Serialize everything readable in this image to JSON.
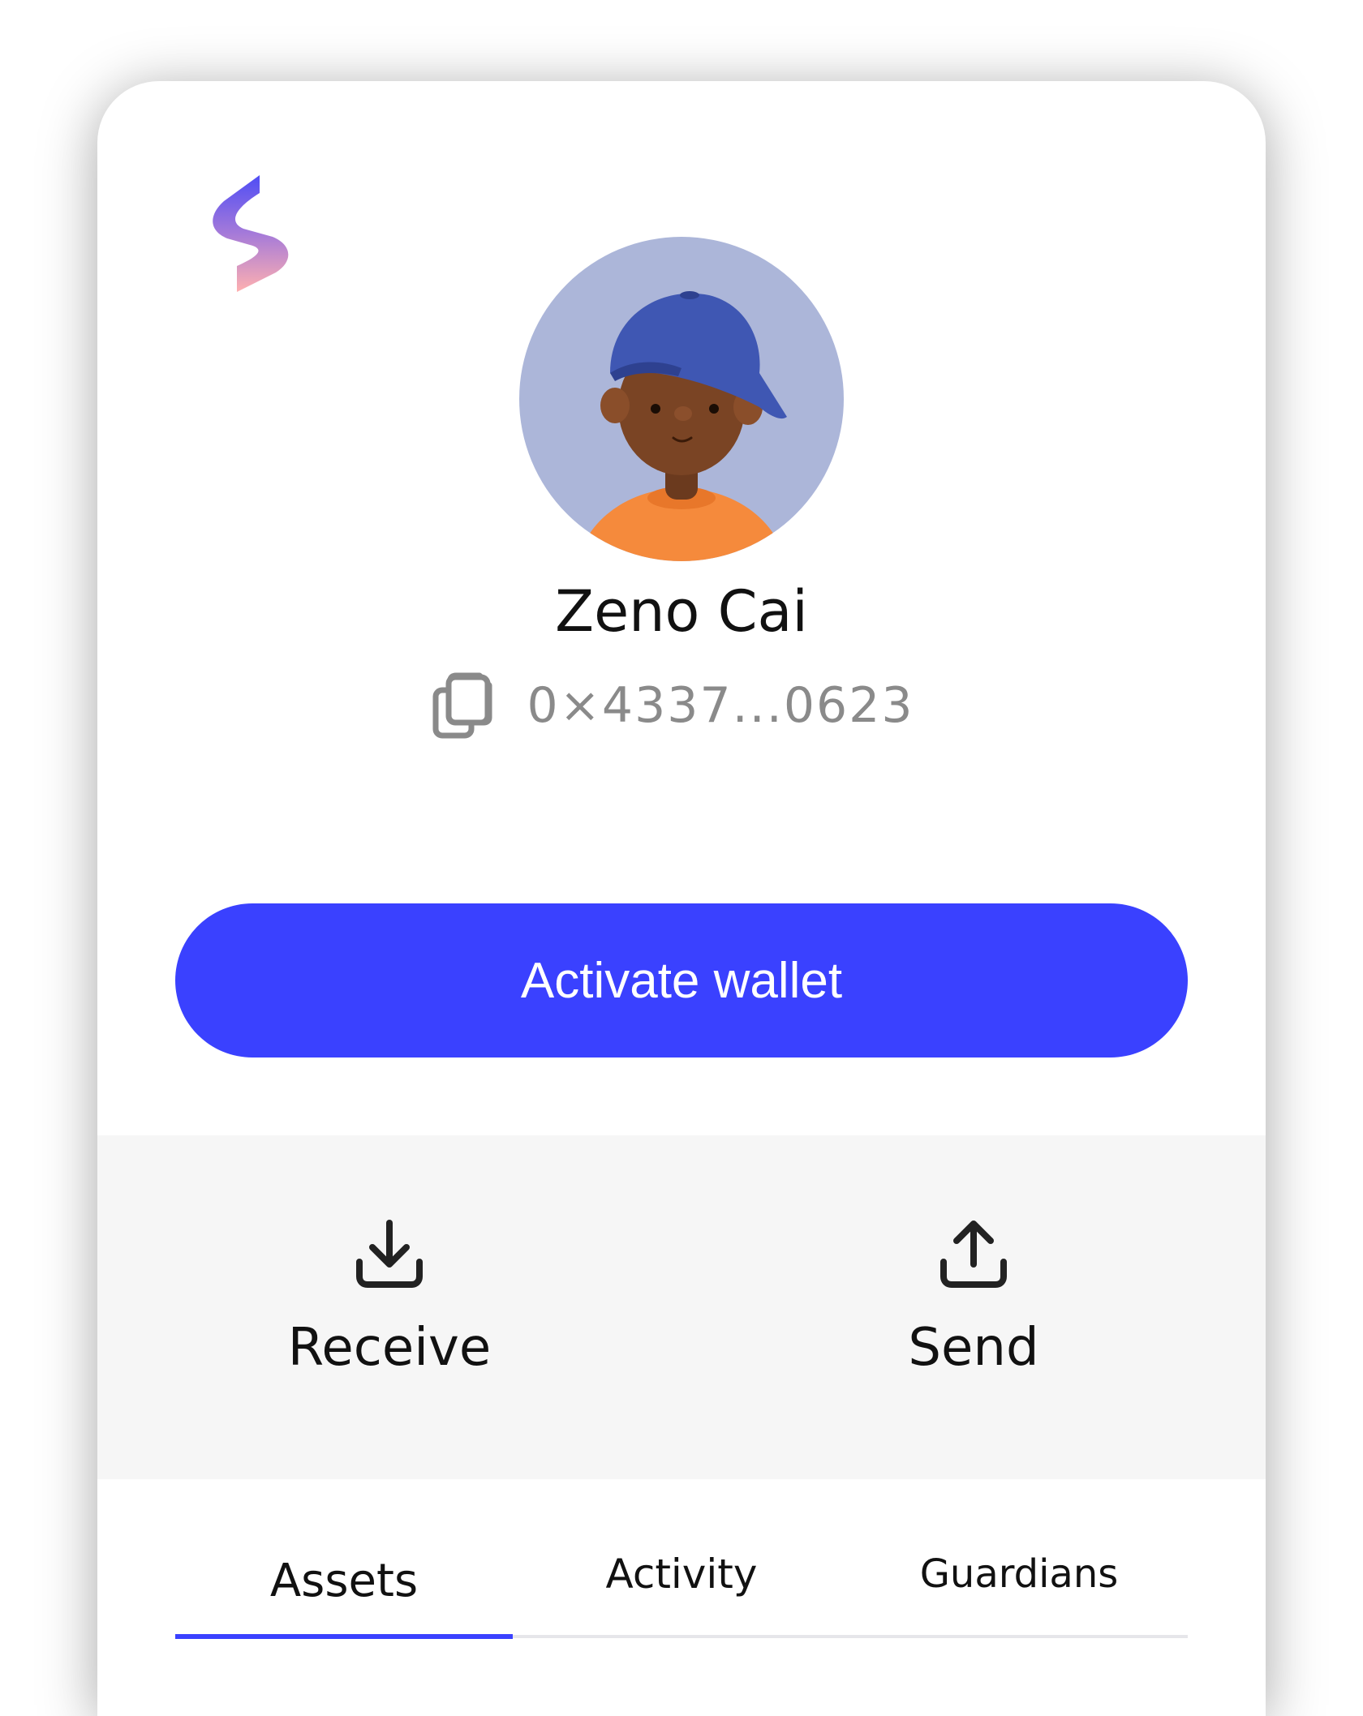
{
  "profile": {
    "name": "Zeno Cai",
    "address": "0×4337...0623"
  },
  "icons": {
    "logo": "bolt-logo",
    "copy": "copy-icon",
    "receive": "download-icon",
    "send": "upload-icon"
  },
  "activate_button": {
    "label": "Activate wallet"
  },
  "actions": [
    {
      "label": "Receive",
      "icon": "download-icon"
    },
    {
      "label": "Send",
      "icon": "upload-icon"
    }
  ],
  "tabs": [
    {
      "label": "Assets",
      "selected": true
    },
    {
      "label": "Activity",
      "selected": false
    },
    {
      "label": "Guardians",
      "selected": false
    }
  ],
  "colors": {
    "accent": "#3a41ff",
    "avatar_bg": "#acb6d9",
    "actions_bg": "#f6f6f6",
    "address_text": "#8a8a8a"
  }
}
